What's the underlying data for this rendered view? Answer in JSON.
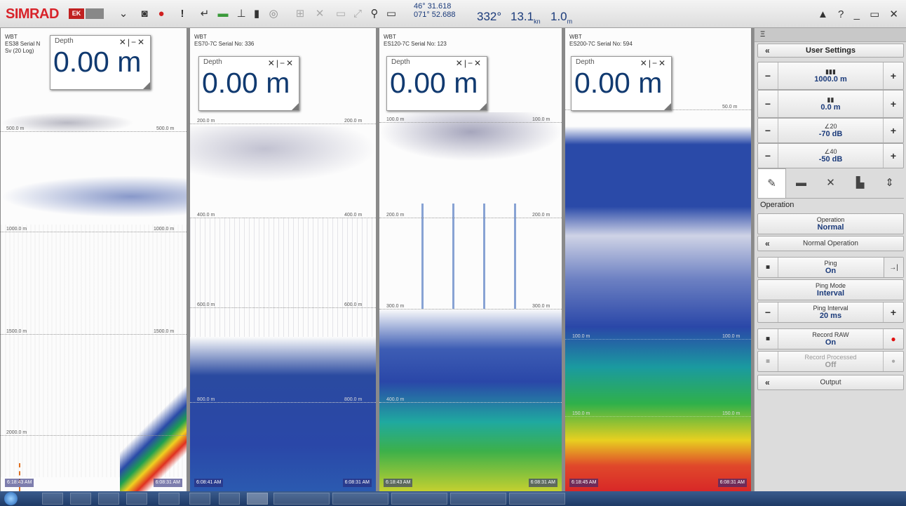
{
  "toolbar": {
    "logo": "SIMRAD",
    "badge1": "EK",
    "readout": {
      "lat": "46° 31.618",
      "lon": "071° 52.688",
      "heading": "332",
      "heading_unit": "°",
      "speed": "13.1",
      "speed_unit": "kn",
      "value4": "1.0",
      "value4_unit": "m"
    },
    "window_controls": "▲ ? _ ▭ ✕"
  },
  "panes": [
    {
      "header_line1": "WBT",
      "header_line2": "ES38 Serial N",
      "header_line3": "Sv (20 Log)",
      "depth_label": "Depth",
      "depth_value": "0.00 m",
      "grid": [
        "500.0 m",
        "1000.0 m",
        "1500.0 m",
        "2000.0 m"
      ],
      "time_left": "6:18:43 AM",
      "time_right": "6:08:31 AM"
    },
    {
      "header_line1": "WBT",
      "header_line2": "ES70-7C Serial No: 336",
      "depth_label": "Depth",
      "depth_value": "0.00 m",
      "grid": [
        "200.0 m",
        "400.0 m",
        "600.0 m",
        "800.0 m"
      ],
      "time_left": "6:08:41 AM",
      "time_right": "6:08:31 AM"
    },
    {
      "header_line1": "WBT",
      "header_line2": "ES120-7C Serial No: 123",
      "depth_label": "Depth",
      "depth_value": "0.00 m",
      "grid": [
        "100.0 m",
        "200.0 m",
        "300.0 m",
        "400.0 m"
      ],
      "time_left": "6:18:43 AM",
      "time_right": "6:08:31 AM"
    },
    {
      "header_line1": "WBT",
      "header_line2": "ES200-7C Serial No: 594",
      "depth_label": "Depth",
      "depth_value": "0.00 m",
      "grid": [
        "50.0 m",
        "100.0 m",
        "150.0 m"
      ],
      "time_left": "6:18:45 AM",
      "time_right": "6:08:31 AM"
    }
  ],
  "side": {
    "top_icon": "Ξ",
    "user_settings": "User Settings",
    "range": "1000.0 m",
    "range_start": "0.0 m",
    "gain1_sup": "20",
    "gain1": "-70 dB",
    "gain2_sup": "40",
    "gain2": "-50 dB",
    "operation_heading": "Operation",
    "operation_label": "Operation",
    "operation_value": "Normal",
    "normal_operation": "Normal Operation",
    "ping_label": "Ping",
    "ping_value": "On",
    "ping_mode_label": "Ping Mode",
    "ping_mode_value": "Interval",
    "ping_interval_label": "Ping Interval",
    "ping_interval_value": "20 ms",
    "record_raw_label": "Record RAW",
    "record_raw_value": "On",
    "record_processed_label": "Record Processed",
    "record_processed_value": "Off",
    "output": "Output"
  }
}
